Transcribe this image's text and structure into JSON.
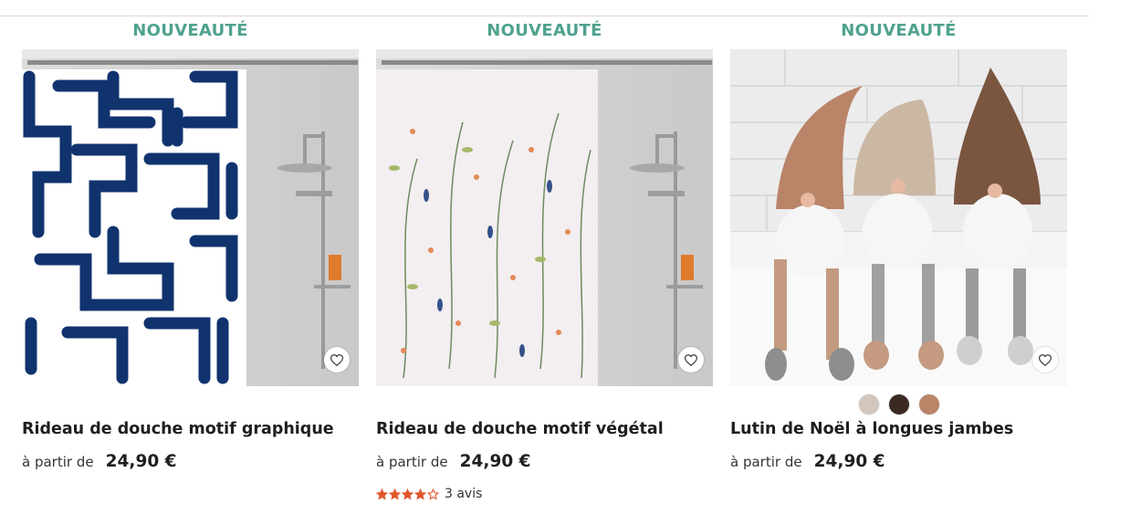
{
  "products": [
    {
      "badge": "NOUVEAUTÉ",
      "title": "Rideau de douche motif graphique",
      "price_prefix": "à partir de",
      "price": "24,90 €"
    },
    {
      "badge": "NOUVEAUTÉ",
      "title": "Rideau de douche motif végétal",
      "price_prefix": "à partir de",
      "price": "24,90 €",
      "rating": 4,
      "rating_max": 5,
      "reviews": "3 avis"
    },
    {
      "badge": "NOUVEAUTÉ",
      "title": "Lutin de Noël à longues jambes",
      "price_prefix": "à partir de",
      "price": "24,90 €",
      "swatches": [
        "#d3c7bd",
        "#3a2a22",
        "#b98468"
      ]
    }
  ],
  "colors": {
    "badge": "#4fa28f",
    "star": "#e0562b"
  },
  "icons": {
    "favorite": "heart-outline-icon",
    "star": "star-icon"
  }
}
